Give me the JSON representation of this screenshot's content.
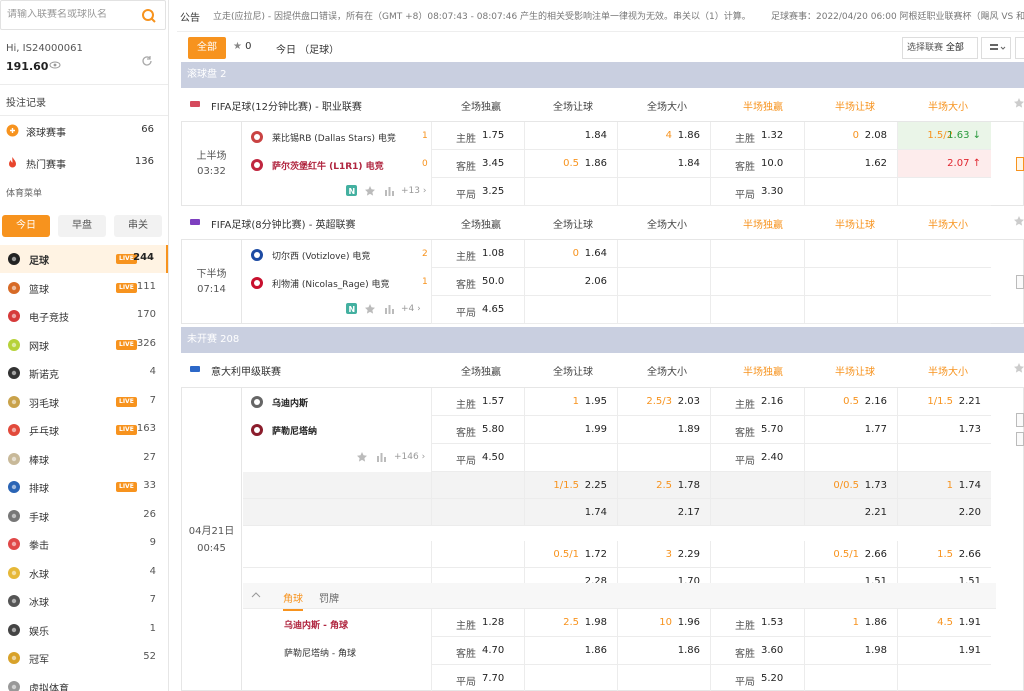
{
  "search": {
    "placeholder": "请输入联赛名或球队名"
  },
  "user": {
    "greeting": "Hi, IS24000061",
    "balance": "191.60"
  },
  "menu": {
    "records": "投注记录",
    "live": {
      "label": "滚球赛事",
      "count": "66"
    },
    "hot": {
      "label": "热门赛事",
      "count": "136"
    },
    "sports_menu": "体育菜单",
    "day_tabs": [
      "今日",
      "早盘",
      "串关"
    ]
  },
  "sports": [
    {
      "label": "足球",
      "live": "LIVE",
      "count": "244",
      "icon": "soccer-ball-icon"
    },
    {
      "label": "篮球",
      "live": "LIVE",
      "count": "111",
      "icon": "basketball-icon"
    },
    {
      "label": "电子竞技",
      "live": "",
      "count": "170",
      "icon": "gamepad-icon"
    },
    {
      "label": "网球",
      "live": "LIVE",
      "count": "326",
      "icon": "tennis-ball-icon"
    },
    {
      "label": "斯诺克",
      "live": "",
      "count": "4",
      "icon": "snooker-ball-icon"
    },
    {
      "label": "羽毛球",
      "live": "LIVE",
      "count": "7",
      "icon": "shuttlecock-icon"
    },
    {
      "label": "乒乓球",
      "live": "LIVE",
      "count": "163",
      "icon": "ping-pong-icon"
    },
    {
      "label": "棒球",
      "live": "",
      "count": "27",
      "icon": "baseball-icon"
    },
    {
      "label": "排球",
      "live": "LIVE",
      "count": "33",
      "icon": "volleyball-icon"
    },
    {
      "label": "手球",
      "live": "",
      "count": "26",
      "icon": "handball-icon"
    },
    {
      "label": "拳击",
      "live": "",
      "count": "9",
      "icon": "boxing-glove-icon"
    },
    {
      "label": "水球",
      "live": "",
      "count": "4",
      "icon": "water-polo-icon"
    },
    {
      "label": "冰球",
      "live": "",
      "count": "7",
      "icon": "ice-hockey-icon"
    },
    {
      "label": "娱乐",
      "live": "",
      "count": "1",
      "icon": "microphone-icon"
    },
    {
      "label": "冠军",
      "live": "",
      "count": "52",
      "icon": "trophy-icon"
    },
    {
      "label": "虚拟体育",
      "live": "",
      "count": "",
      "icon": "virtual-sport-icon"
    }
  ],
  "notice": {
    "tag": "公告",
    "text": "立走(应拉尼) - 因提供盘口错误，所有在（GMT +8）08:07:43 - 08:07:46 产生的相关受影响注单一律视为无效。串关以（1）计算。",
    "text2": "足球赛事：2022/04/20 06:00 阿根廷职业联赛杯（飓风 VS 和"
  },
  "toolbar": {
    "all": "全部",
    "star_count": "0",
    "today": "今日 （足球）",
    "select_label": "选择联赛",
    "select_value": "全部"
  },
  "colors": {
    "accent": "#f7931e",
    "section": "#c9cfe0",
    "up": "#e0262f",
    "down": "#2b9a3e"
  },
  "headers": [
    "全场独赢",
    "全场让球",
    "全场大小",
    "半场独赢",
    "半场让球",
    "半场大小"
  ],
  "sections": {
    "live": "滚球盘  2",
    "upcoming": "未开赛  208"
  },
  "live_leagues": [
    {
      "name": "FIFA足球(12分钟比赛) - 职业联赛",
      "period": "上半场",
      "clock": "03:32",
      "home": "莱比锡RB (Dallas Stars) 电竞",
      "home_score": "1",
      "away": "萨尔茨堡红牛 (L1R1) 电竞",
      "away_score": "0",
      "more": "+13",
      "rows": [
        [
          "主胜",
          "1.75",
          "",
          "1.84",
          "4",
          "1.86",
          "主胜",
          "1.32",
          "0",
          "2.08",
          "1.5/2",
          "1.63"
        ],
        [
          "客胜",
          "3.45",
          "0.5",
          "1.86",
          "",
          "1.84",
          "客胜",
          "10.0",
          "",
          "1.62",
          "",
          "2.07"
        ],
        [
          "平局",
          "3.25",
          "",
          "",
          "",
          "",
          "平局",
          "3.30",
          "",
          "",
          "",
          ""
        ]
      ]
    },
    {
      "name": "FIFA足球(8分钟比赛) - 英超联赛",
      "period": "下半场",
      "clock": "07:14",
      "home": "切尔西 (Votizlove) 电竞",
      "home_score": "2",
      "away": "利物浦 (Nicolas_Rage) 电竞",
      "away_score": "1",
      "more": "+4",
      "rows": [
        [
          "主胜",
          "1.08",
          "0",
          "1.64",
          "",
          "",
          "",
          "",
          "",
          "",
          "",
          ""
        ],
        [
          "客胜",
          "50.0",
          "",
          "2.06",
          "",
          "",
          "",
          "",
          "",
          "",
          "",
          ""
        ],
        [
          "平局",
          "4.65",
          "",
          "",
          "",
          "",
          "",
          "",
          "",
          "",
          "",
          ""
        ]
      ]
    }
  ],
  "serie_a": {
    "name": "意大利甲级联赛",
    "date": "04月21日",
    "time": "00:45",
    "home": "乌迪内斯",
    "away": "萨勒尼塔纳",
    "more": "+146",
    "rows": [
      [
        "主胜",
        "1.57",
        "1",
        "1.95",
        "2.5/3",
        "2.03",
        "主胜",
        "2.16",
        "0.5",
        "2.16",
        "1/1.5",
        "2.21"
      ],
      [
        "客胜",
        "5.80",
        "",
        "1.99",
        "",
        "1.89",
        "客胜",
        "5.70",
        "",
        "1.77",
        "",
        "1.73"
      ],
      [
        "平局",
        "4.50",
        "",
        "",
        "",
        "",
        "平局",
        "2.40",
        "",
        "",
        "",
        ""
      ],
      [
        "",
        "",
        "1/1.5",
        "2.25",
        "2.5",
        "1.78",
        "",
        "",
        "0/0.5",
        "1.73",
        "1",
        "1.74"
      ],
      [
        "",
        "",
        "",
        "1.74",
        "",
        "2.17",
        "",
        "",
        "",
        "2.21",
        "",
        "2.20"
      ],
      [
        "",
        "",
        "0.5/1",
        "1.72",
        "3",
        "2.29",
        "",
        "",
        "0.5/1",
        "2.66",
        "1.5",
        "2.66"
      ],
      [
        "",
        "",
        "",
        "2.28",
        "",
        "1.70",
        "",
        "",
        "",
        "1.51",
        "",
        "1.51"
      ]
    ],
    "subtabs": [
      "角球",
      "罚牌"
    ],
    "corner_home": "乌迪内斯 - 角球",
    "corner_away": "萨勒尼塔纳 - 角球",
    "corner_rows": [
      [
        "主胜",
        "1.28",
        "2.5",
        "1.98",
        "10",
        "1.96",
        "主胜",
        "1.53",
        "1",
        "1.86",
        "4.5",
        "1.91"
      ],
      [
        "客胜",
        "4.70",
        "",
        "1.86",
        "",
        "1.86",
        "客胜",
        "3.60",
        "",
        "1.98",
        "",
        "1.91"
      ],
      [
        "平局",
        "7.70",
        "",
        "",
        "",
        "",
        "平局",
        "5.20",
        "",
        "",
        "",
        ""
      ]
    ]
  }
}
